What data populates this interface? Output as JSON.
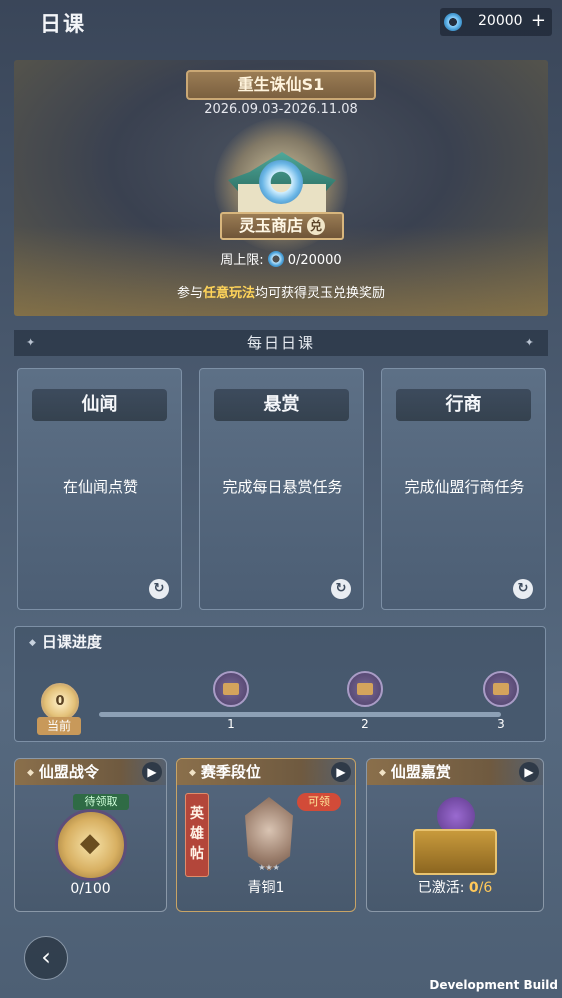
{
  "header": {
    "title": "日课",
    "currency_amount": "20000",
    "currency_icon": "jade-icon",
    "add_label": "+"
  },
  "banner": {
    "season_title": "重生诛仙S1",
    "date_range": "2026.09.03-2026.11.08",
    "shop_name": "灵玉商店",
    "shop_badge": "兑",
    "weekly_label": "周上限:",
    "weekly_value": "0/20000",
    "hint_prefix": "参与",
    "hint_highlight": "任意玩法",
    "hint_suffix": "均可获得灵玉兑换奖励"
  },
  "daily_section": {
    "title": "每日日课"
  },
  "tasks": [
    {
      "title": "仙闻",
      "desc": "在仙闻点赞"
    },
    {
      "title": "悬赏",
      "desc": "完成每日悬赏任务"
    },
    {
      "title": "行商",
      "desc": "完成仙盟行商任务"
    }
  ],
  "progress": {
    "title": "日课进度",
    "current_value": "0",
    "current_label": "当前",
    "milestones": [
      "1",
      "2",
      "3"
    ],
    "fill_fraction": 0
  },
  "cards": {
    "battle_pass": {
      "title": "仙盟战令",
      "status": "待领取",
      "progress": "0/100"
    },
    "season_rank": {
      "title": "赛季段位",
      "hero_label": "英雄帖",
      "claim_badge": "可领",
      "rank": "青铜1"
    },
    "bounty": {
      "title": "仙盟嘉赏",
      "activated_label": "已激活:",
      "activated_current": "0",
      "activated_total": "/6"
    }
  },
  "footer": {
    "back_icon": "back-arrow-icon",
    "dev_build": "Development Build"
  },
  "colors": {
    "highlight": "#ffd45a",
    "gold": "#c8a466",
    "jade": "#4aa0d8"
  }
}
